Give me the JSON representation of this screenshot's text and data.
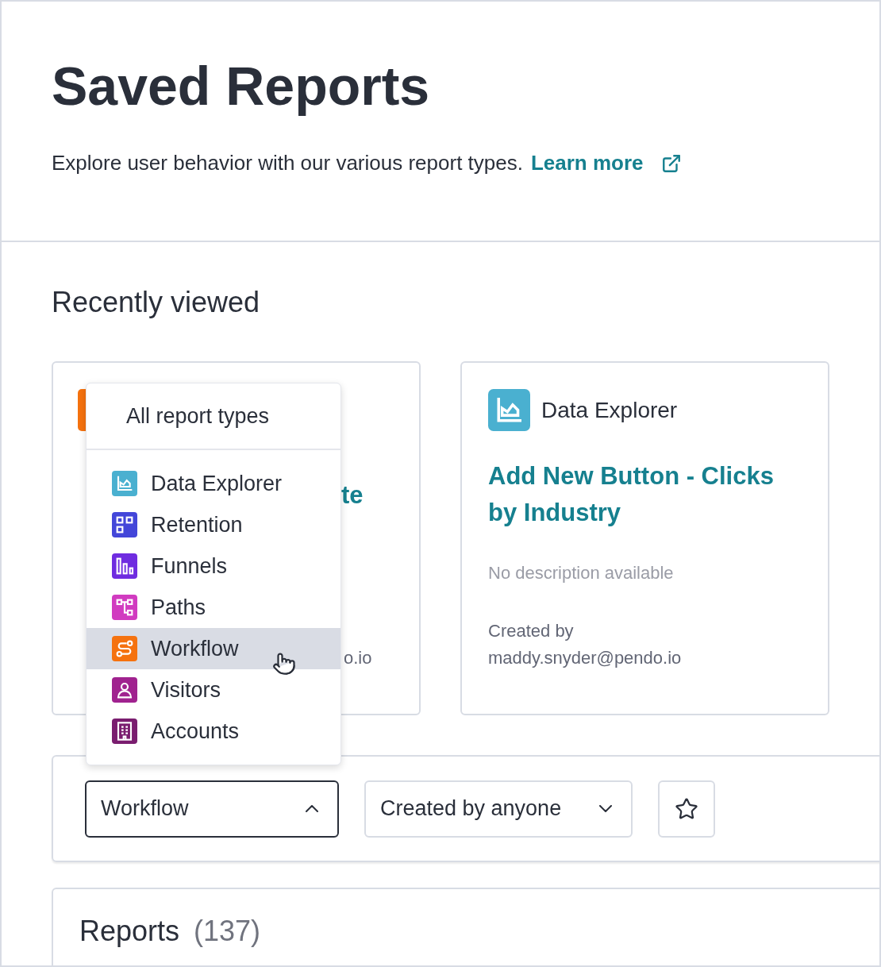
{
  "header": {
    "title": "Saved Reports",
    "subtitle": "Explore user behavior with our various report types.",
    "learn_more": "Learn more"
  },
  "recently_viewed": {
    "heading": "Recently viewed",
    "cards": [
      {
        "kind": "covered",
        "title_fragment": "te",
        "creator_fragment": "o.io"
      },
      {
        "kind": "full",
        "type": "Data Explorer",
        "title": "Add New Button - Clicks by Industry",
        "description": "No description available",
        "created_by": "Created by",
        "creator": "maddy.snyder@pendo.io"
      }
    ]
  },
  "dropdown": {
    "header": "All report types",
    "items": [
      {
        "label": "Data Explorer",
        "color": "#4ab0d0",
        "selected": false
      },
      {
        "label": "Retention",
        "color": "#4346d9",
        "selected": false
      },
      {
        "label": "Funnels",
        "color": "#6f2ce0",
        "selected": false
      },
      {
        "label": "Paths",
        "color": "#d13bc0",
        "selected": false
      },
      {
        "label": "Workflow",
        "color": "#f5720f",
        "selected": true
      },
      {
        "label": "Visitors",
        "color": "#a0228f",
        "selected": false
      },
      {
        "label": "Accounts",
        "color": "#7a1d6f",
        "selected": false
      }
    ]
  },
  "filters": {
    "type_select": {
      "value": "Workflow",
      "expanded": true
    },
    "creator_select": {
      "value": "Created by anyone",
      "expanded": false
    },
    "favorites": {
      "on": false
    }
  },
  "reports": {
    "title": "Reports",
    "count": "(137)"
  }
}
